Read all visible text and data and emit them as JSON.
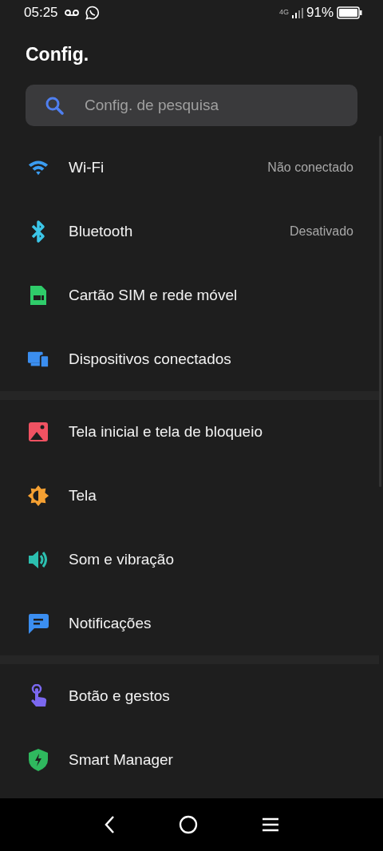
{
  "status_bar": {
    "time": "05:25",
    "network": "4G",
    "battery": "91%"
  },
  "title": "Config.",
  "search": {
    "placeholder": "Config. de pesquisa"
  },
  "groups": [
    {
      "items": [
        {
          "label": "Wi-Fi",
          "value": "Não conectado"
        },
        {
          "label": "Bluetooth",
          "value": "Desativado"
        },
        {
          "label": "Cartão SIM e rede móvel"
        },
        {
          "label": "Dispositivos conectados"
        }
      ]
    },
    {
      "items": [
        {
          "label": "Tela inicial e tela de bloqueio"
        },
        {
          "label": "Tela"
        },
        {
          "label": "Som e vibração"
        },
        {
          "label": "Notificações"
        }
      ]
    },
    {
      "items": [
        {
          "label": "Botão e gestos"
        },
        {
          "label": "Smart Manager"
        }
      ]
    }
  ]
}
